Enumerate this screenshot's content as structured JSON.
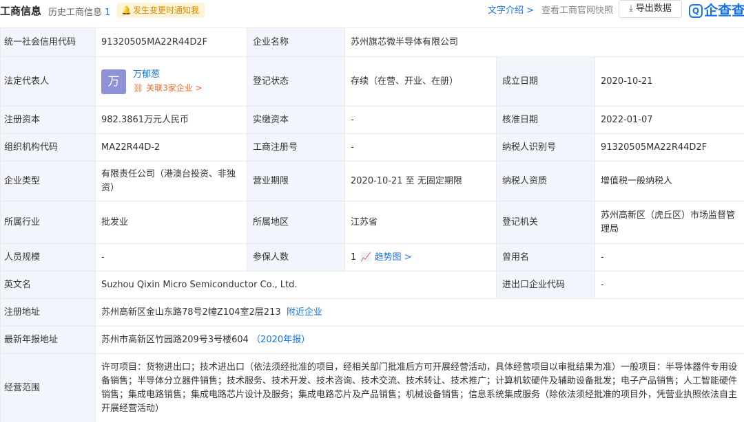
{
  "header": {
    "title": "工商信息",
    "history_label": "历史工商信息",
    "history_count": "1",
    "notify_label": "发生变更时通知我",
    "intro_link": "文字介绍 >",
    "snapshot_link": "查看工商官网快照",
    "export_label": "导出数据",
    "brand": "企查查",
    "brand_logo_char": "Q"
  },
  "fields": {
    "credit_code": {
      "label": "统一社会信用代码",
      "value": "91320505MA22R44D2F"
    },
    "company_name": {
      "label": "企业名称",
      "value": "苏州旗芯微半导体有限公司"
    },
    "legal_rep": {
      "label": "法定代表人",
      "avatar_char": "万",
      "name": "万郁葱",
      "related": "关联3家企业 >"
    },
    "reg_status": {
      "label": "登记状态",
      "value": "存续（在营、开业、在册）"
    },
    "established": {
      "label": "成立日期",
      "value": "2020-10-21"
    },
    "reg_capital": {
      "label": "注册资本",
      "value": "982.3861万元人民币"
    },
    "paid_capital": {
      "label": "实缴资本",
      "value": "-"
    },
    "approved_date": {
      "label": "核准日期",
      "value": "2022-01-07"
    },
    "org_code": {
      "label": "组织机构代码",
      "value": "MA22R44D-2"
    },
    "biz_reg_no": {
      "label": "工商注册号",
      "value": "-"
    },
    "taxpayer_id": {
      "label": "纳税人识别号",
      "value": "91320505MA22R44D2F"
    },
    "company_type": {
      "label": "企业类型",
      "value": "有限责任公司（港澳台投资、非独资）"
    },
    "biz_term": {
      "label": "营业期限",
      "value": "2020-10-21 至 无固定期限"
    },
    "taxpayer_qual": {
      "label": "纳税人资质",
      "value": "增值税一般纳税人"
    },
    "industry": {
      "label": "所属行业",
      "value": "批发业"
    },
    "region": {
      "label": "所属地区",
      "value": "江苏省"
    },
    "reg_authority": {
      "label": "登记机关",
      "value": "苏州高新区（虎丘区）市场监督管理局"
    },
    "staff_size": {
      "label": "人员规模",
      "value": "-"
    },
    "insured": {
      "label": "参保人数",
      "value": "1",
      "trend_link": "趋势图 >"
    },
    "former_name": {
      "label": "曾用名",
      "value": "-"
    },
    "english_name": {
      "label": "英文名",
      "value": "Suzhou Qixin Micro Semiconductor Co., Ltd."
    },
    "ie_code": {
      "label": "进出口企业代码",
      "value": "-"
    },
    "reg_address": {
      "label": "注册地址",
      "value": "苏州高新区金山东路78号2幢Z104室2层213",
      "link": "附近企业"
    },
    "annual_address": {
      "label": "最新年报地址",
      "value": "苏州市高新区竹园路209号3号楼604",
      "link": "（2020年报）"
    },
    "biz_scope": {
      "label": "经营范围",
      "value": "许可项目：货物进出口；技术进出口（依法须经批准的项目，经相关部门批准后方可开展经营活动，具体经营项目以审批结果为准）一般项目：半导体器件专用设备销售；半导体分立器件销售；技术服务、技术开发、技术咨询、技术交流、技术转让、技术推广；计算机软硬件及辅助设备批发；电子产品销售；人工智能硬件销售；集成电路销售；集成电路芯片设计及服务；集成电路芯片及产品销售；机械设备销售；信息系统集成服务（除依法须经批准的项目外，凭营业执照依法自主开展经营活动）"
    }
  },
  "colors": {
    "label_bg": "#f2f5fb",
    "link_blue": "#1a73e8",
    "accent_orange": "#ee6a2c",
    "notify_bg": "#fdf3d8"
  }
}
